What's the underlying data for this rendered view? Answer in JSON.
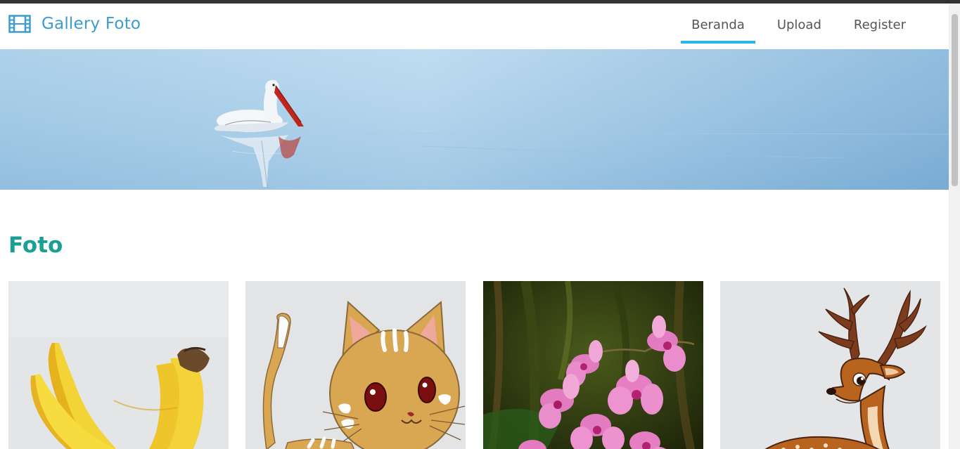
{
  "brand": {
    "title": "Gallery Foto",
    "icon": "film-icon",
    "color": "#3c9ccf"
  },
  "nav": {
    "items": [
      {
        "label": "Beranda",
        "active": true
      },
      {
        "label": "Upload",
        "active": false
      },
      {
        "label": "Register",
        "active": false
      }
    ],
    "active_indicator_color": "#29b6e8"
  },
  "hero": {
    "description": "pelican-on-calm-water"
  },
  "section": {
    "title": "Foto",
    "color": "#1a9e96"
  },
  "photos": [
    {
      "subject": "bananas"
    },
    {
      "subject": "cartoon-cat"
    },
    {
      "subject": "pink-orchids"
    },
    {
      "subject": "cartoon-deer"
    }
  ]
}
